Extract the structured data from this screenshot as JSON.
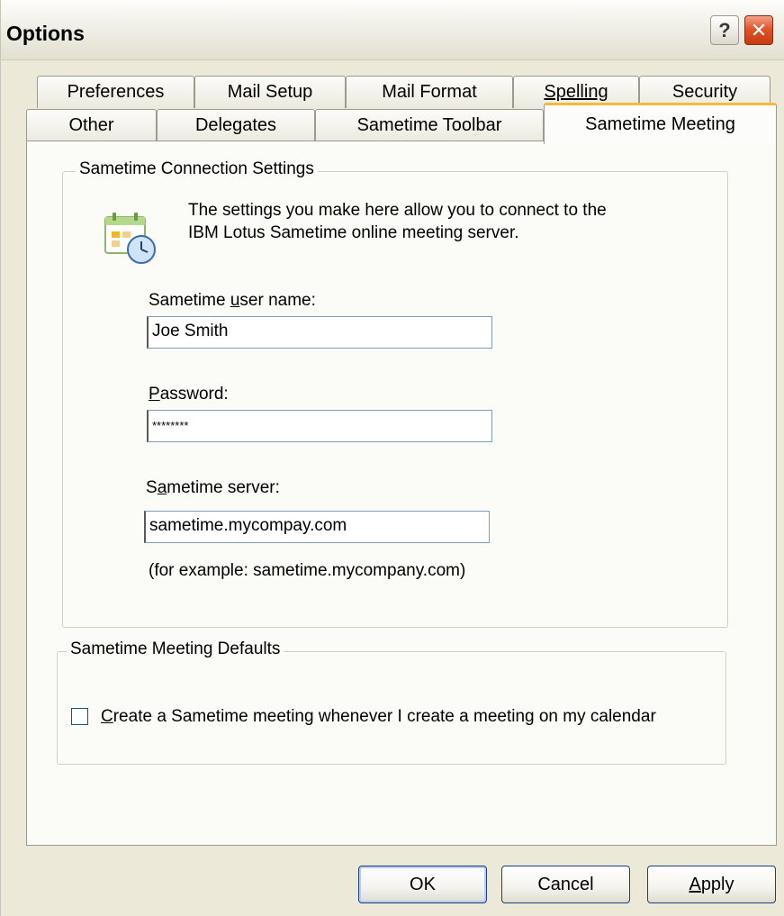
{
  "window": {
    "title": "Options",
    "help_symbol": "?",
    "close_symbol": "✕"
  },
  "tabs": {
    "row1": [
      "Preferences",
      "Mail Setup",
      "Mail Format",
      "Spelling",
      "Security"
    ],
    "row2": [
      "Other",
      "Delegates",
      "Sametime Toolbar",
      "Sametime Meeting"
    ],
    "active": "Sametime Meeting"
  },
  "connection": {
    "legend": "Sametime Connection Settings",
    "icon": "calendar-clock-icon",
    "info_line1": "The settings you make here allow you to connect to the",
    "info_line2": "IBM Lotus Sametime online meeting server.",
    "username_label_pre": "Sametime ",
    "username_label_u": "u",
    "username_label_post": "ser name:",
    "username_value": "Joe Smith",
    "password_label_u": "P",
    "password_label_post": "assword:",
    "password_value": "********",
    "server_label_pre": "S",
    "server_label_u": "a",
    "server_label_post": "metime server:",
    "server_value": "sametime.mycompay.com",
    "server_hint": "(for example: sametime.mycompany.com)"
  },
  "defaults": {
    "legend": "Sametime Meeting Defaults",
    "checkbox_checked": false,
    "checkbox_label_u": "C",
    "checkbox_label_post": "reate a Sametime meeting whenever I create a meeting on my calendar"
  },
  "buttons": {
    "ok": "OK",
    "cancel": "Cancel",
    "apply_u": "A",
    "apply_post": "pply"
  },
  "colors": {
    "accent_tab": "#f4ba3c",
    "close_button": "#e2552a",
    "dialog_bg": "#ece9d8"
  }
}
